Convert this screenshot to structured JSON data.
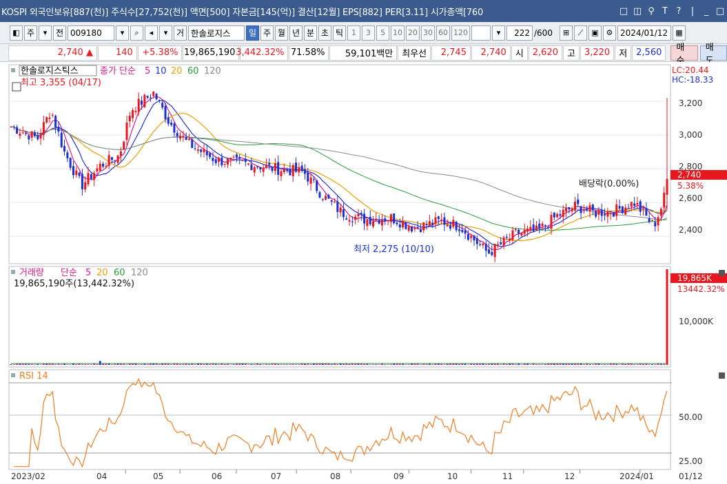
{
  "window": {
    "title": "KOSPI 외국인보유[887(천)] 주식수[27,752(천)] 액면[500] 자본금[145(억)] 결산[12월] EPS[882] PER[3.11] 시가총액[760",
    "btn_restore": "□",
    "btn_dock": "◫",
    "btn_pin": "⚲",
    "btn_font": "T",
    "btn_help": "?",
    "btn_sep": "|",
    "btn_min": "_",
    "btn_max": "□",
    "btn_close": "×"
  },
  "toolbar": {
    "tab_stock": "주",
    "tab_all": "전",
    "stock_code": "009180",
    "stock_name": "한솔로지스",
    "btn_hold": "거",
    "periods": [
      "일",
      "주",
      "월",
      "년",
      "분",
      "초",
      "틱"
    ],
    "selected_period": "일",
    "intervals": [
      "1",
      "3",
      "5",
      "10",
      "20",
      "30",
      "60",
      "120"
    ],
    "count": "222",
    "count_total": "/600",
    "date": "2024/01/12"
  },
  "quote": {
    "price": "2,740",
    "change_arrow": "▲",
    "change": "140",
    "change_pct": "+5.38%",
    "volume": "19,865,190",
    "volume_ratio": "3,442.32%",
    "turnover_pct": "71.58%",
    "amount": "59,101백만",
    "best_label": "최우선",
    "best_ask": "2,745",
    "best_bid": "2,740",
    "open_label": "시",
    "open": "2,620",
    "high_label": "고",
    "high": "3,220",
    "low_label": "저",
    "low": "2,560",
    "buy_button": "매수",
    "sell_button": "매도"
  },
  "price_panel": {
    "title": "한솔로지스틱스",
    "ma_label": "종가 단순",
    "ma_periods": [
      "5",
      "10",
      "20",
      "60",
      "120"
    ],
    "ma_colors": [
      "#d9188c",
      "#2233cc",
      "#e8a000",
      "#2a9a3a",
      "#8a8a8a"
    ],
    "lc": "LC:20.44",
    "hc": "HC:-18.33",
    "high_note": "최고 3,355 (04/17)",
    "low_note": "최저 2,275 (10/10)",
    "dividend_note": "배당락(0.00%)",
    "last_price": "2,740",
    "last_pct": "5.38%",
    "y_labels": [
      "3,200",
      "3,000",
      "2,800",
      "2,600",
      "2,400"
    ]
  },
  "volume_panel": {
    "title": "거래량",
    "ma_label": "단순",
    "ma_periods": [
      "5",
      "20",
      "60",
      "120"
    ],
    "value_line": "19,865,190주(13,442.32%)",
    "last_value": "19,865K",
    "last_pct": "13442.32%",
    "y_labels": [
      "10,000K"
    ]
  },
  "rsi_panel": {
    "title": "RSI 14",
    "y_labels": [
      "50.00",
      "25.00"
    ]
  },
  "x_axis": {
    "labels": [
      "2023/02",
      "04",
      "05",
      "06",
      "07",
      "08",
      "09",
      "10",
      "11",
      "12",
      "2024/01"
    ],
    "right_label": "01/12"
  },
  "colors": {
    "up": "#e8171d",
    "down": "#1a2fd1",
    "rsi": "#ef7d22",
    "title_bar": "#3b5b8f",
    "selected": "#3a6fc4"
  },
  "chart_data": {
    "type": "candlestick",
    "y_range": [
      2250,
      3400
    ],
    "volume_range": [
      0,
      20000000
    ],
    "rsi_range": [
      20,
      80
    ],
    "dividend_date": "2023/12/26",
    "series": [
      {
        "name": "종가",
        "points": [
          [
            "2023/02/01",
            3050
          ],
          [
            "2023/02/15",
            2980
          ],
          [
            "2023/02/22",
            3150
          ],
          [
            "2023/03/01",
            2900
          ],
          [
            "2023/03/10",
            2700
          ],
          [
            "2023/03/20",
            2820
          ],
          [
            "2023/03/30",
            2880
          ],
          [
            "2023/04/05",
            3150
          ],
          [
            "2023/04/17",
            3250
          ],
          [
            "2023/04/25",
            3080
          ],
          [
            "2023/05/05",
            2950
          ],
          [
            "2023/05/20",
            2850
          ],
          [
            "2023/06/05",
            2830
          ],
          [
            "2023/06/20",
            2800
          ],
          [
            "2023/07/05",
            2780
          ],
          [
            "2023/07/15",
            2640
          ],
          [
            "2023/07/25",
            2540
          ],
          [
            "2023/08/05",
            2500
          ],
          [
            "2023/08/20",
            2510
          ],
          [
            "2023/09/01",
            2450
          ],
          [
            "2023/09/15",
            2490
          ],
          [
            "2023/09/25",
            2460
          ],
          [
            "2023/10/10",
            2300
          ],
          [
            "2023/10/25",
            2420
          ],
          [
            "2023/11/05",
            2430
          ],
          [
            "2023/11/15",
            2520
          ],
          [
            "2023/11/25",
            2580
          ],
          [
            "2023/12/05",
            2540
          ],
          [
            "2023/12/15",
            2550
          ],
          [
            "2023/12/26",
            2600
          ],
          [
            "2024/01/05",
            2460
          ],
          [
            "2024/01/10",
            2600
          ],
          [
            "2024/01/12",
            2740
          ]
        ]
      }
    ]
  }
}
